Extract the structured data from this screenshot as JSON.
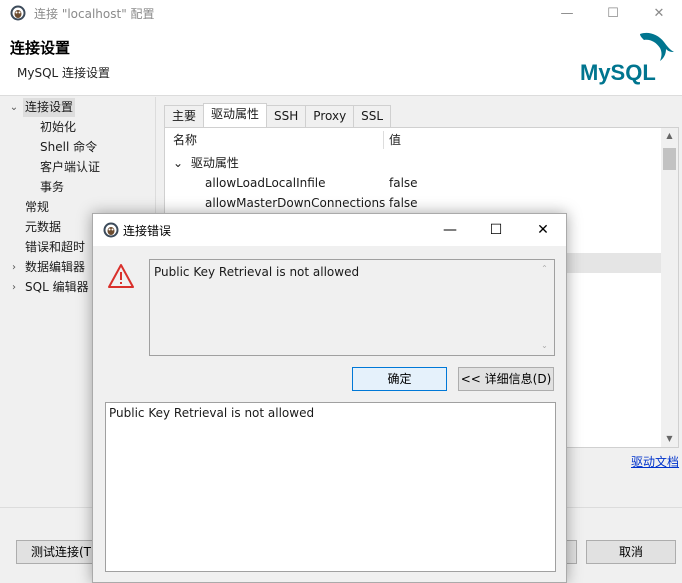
{
  "window": {
    "title": "连接 \"localhost\" 配置",
    "minimize": "—",
    "maximize": "☐",
    "close": "✕"
  },
  "header": {
    "title": "连接设置",
    "subtitle": "MySQL 连接设置",
    "logo_text": "MySQL"
  },
  "tree": {
    "items": [
      {
        "label": "连接设置",
        "arrow": "⌄",
        "selected": true
      },
      {
        "label": "初始化"
      },
      {
        "label": "Shell 命令"
      },
      {
        "label": "客户端认证"
      },
      {
        "label": "事务"
      },
      {
        "label": "常规"
      },
      {
        "label": "元数据"
      },
      {
        "label": "错误和超时"
      },
      {
        "label": "数据编辑器",
        "arrow": "›"
      },
      {
        "label": "SQL 编辑器",
        "arrow": "›"
      }
    ]
  },
  "tabs": [
    "主要",
    "驱动属性",
    "SSH",
    "Proxy",
    "SSL"
  ],
  "table": {
    "col_name": "名称",
    "col_value": "值",
    "group_arrow": "⌄",
    "group_label": "驱动属性",
    "rows": [
      {
        "name": "allowLoadLocalInfile",
        "value": "false"
      },
      {
        "name": "allowMasterDownConnections",
        "value": "false"
      }
    ]
  },
  "driver_doc_link": "驱动文档",
  "buttons": {
    "test_connection": "测试连接(T",
    "cancel": "取消"
  },
  "dialog": {
    "title": "连接错误",
    "minimize": "—",
    "maximize": "☐",
    "close": "✕",
    "message": "Public Key Retrieval is not allowed",
    "ok": "确定",
    "details": "<< 详细信息(D)",
    "detail_text": "Public Key Retrieval is not allowed"
  },
  "colors": {
    "link": "#0033cc",
    "warning": "#d9302b",
    "mysql_blue": "#00758f",
    "mysql_orange": "#f29111",
    "primary_border": "#0078d7"
  }
}
